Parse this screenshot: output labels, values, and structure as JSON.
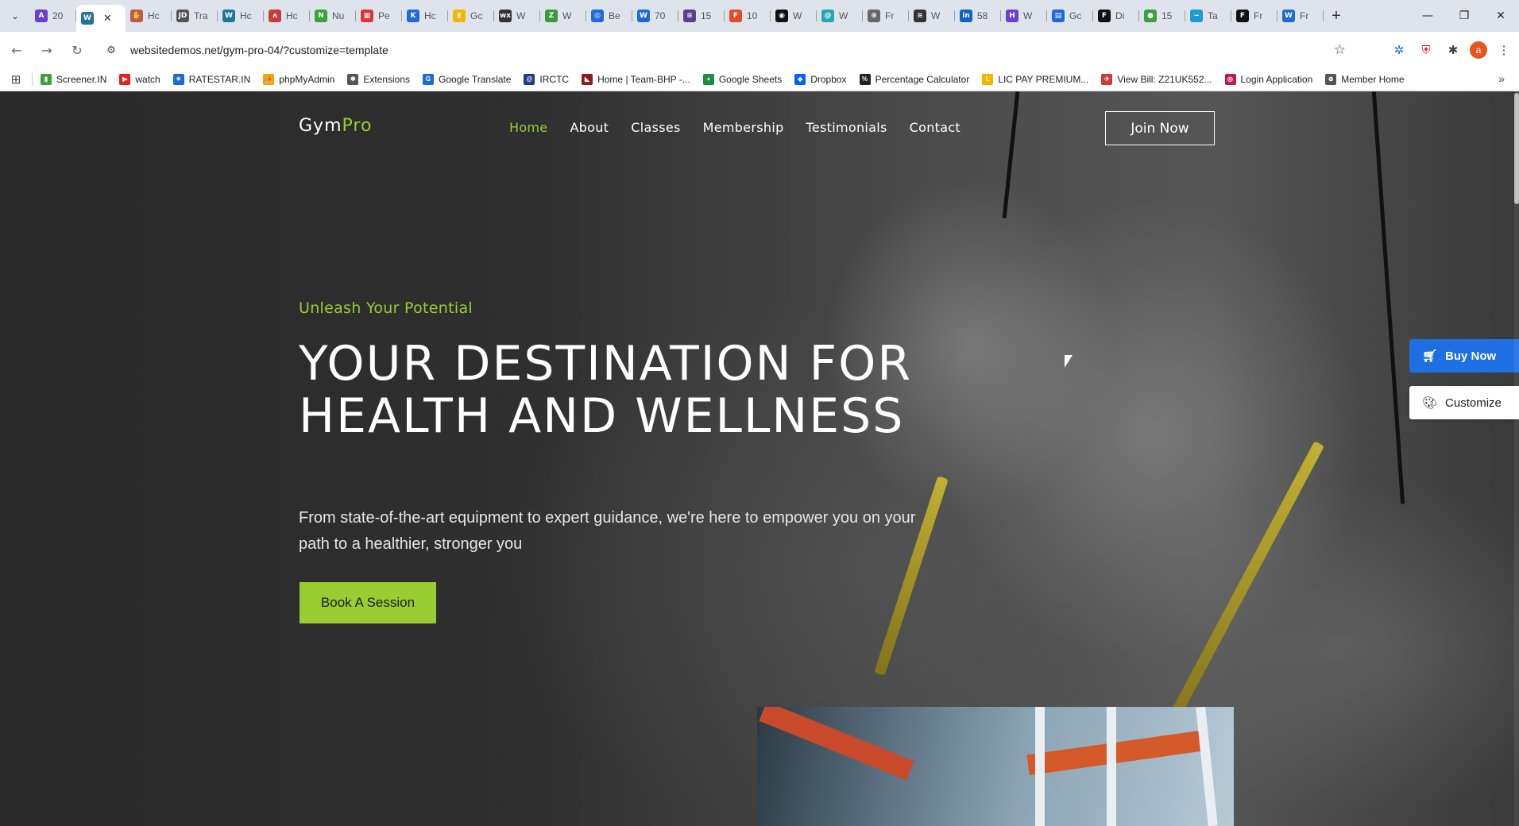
{
  "browser": {
    "tabs": [
      {
        "label": "20",
        "icon": "app-icon",
        "color": "#6b3fd6",
        "glyph": "A"
      },
      {
        "label": "",
        "icon": "wordpress-icon",
        "color": "#21759b",
        "glyph": "W",
        "active": true
      },
      {
        "label": "Hc",
        "icon": "hands-icon",
        "color": "#c0574a",
        "glyph": "✋"
      },
      {
        "label": "Tra",
        "icon": "jd-icon",
        "color": "#555555",
        "glyph": "JD"
      },
      {
        "label": "Hc",
        "icon": "wordpress-icon",
        "color": "#21759b",
        "glyph": "W"
      },
      {
        "label": "Hc",
        "icon": "wings-icon",
        "color": "#c83b3b",
        "glyph": "ʌ"
      },
      {
        "label": "Nu",
        "icon": "leaf-icon",
        "color": "#3aa13a",
        "glyph": "N"
      },
      {
        "label": "Pe",
        "icon": "calendar-icon",
        "color": "#d33",
        "glyph": "▦"
      },
      {
        "label": "Hc",
        "icon": "k-icon",
        "color": "#1e6bd6",
        "glyph": "K"
      },
      {
        "label": "Gc",
        "icon": "google-keep-icon",
        "color": "#f4b400",
        "glyph": "▮"
      },
      {
        "label": "W",
        "icon": "wix-icon",
        "color": "#333333",
        "glyph": "wx"
      },
      {
        "label": "W",
        "icon": "zoho-icon",
        "color": "#3a9a3a",
        "glyph": "Z"
      },
      {
        "label": "Be",
        "icon": "target-icon",
        "color": "#1e6bd6",
        "glyph": "◎"
      },
      {
        "label": "70",
        "icon": "word-icon",
        "color": "#1e6bd6",
        "glyph": "W"
      },
      {
        "label": "15",
        "icon": "stack-icon",
        "color": "#5b3f8a",
        "glyph": "≡"
      },
      {
        "label": "10",
        "icon": "figma-icon",
        "color": "#e24a2a",
        "glyph": "F"
      },
      {
        "label": "W",
        "icon": "gauge-icon",
        "color": "#111111",
        "glyph": "◉"
      },
      {
        "label": "W",
        "icon": "swirl-icon",
        "color": "#26a6b4",
        "glyph": "@"
      },
      {
        "label": "Fr",
        "icon": "globe-icon",
        "color": "#666666",
        "glyph": "⊕"
      },
      {
        "label": "W",
        "icon": "stripes-icon",
        "color": "#333333",
        "glyph": "≋"
      },
      {
        "label": "58",
        "icon": "linkedin-icon",
        "color": "#0a66c2",
        "glyph": "in"
      },
      {
        "label": "W",
        "icon": "h-icon",
        "color": "#6b3fd6",
        "glyph": "H"
      },
      {
        "label": "Gc",
        "icon": "table-icon",
        "color": "#1e6bd6",
        "glyph": "▤"
      },
      {
        "label": "Di",
        "icon": "f-circle-icon",
        "color": "#111111",
        "glyph": "F"
      },
      {
        "label": "15",
        "icon": "green-drop-icon",
        "color": "#3aa13a",
        "glyph": "●"
      },
      {
        "label": "Ta",
        "icon": "wave-icon",
        "color": "#1e9bd6",
        "glyph": "~"
      },
      {
        "label": "Fr",
        "icon": "fr-icon",
        "color": "#111111",
        "glyph": "F"
      },
      {
        "label": "Fr",
        "icon": "word-icon",
        "color": "#1e6bd6",
        "glyph": "W"
      }
    ],
    "url": "websitedemos.net/gym-pro-04/?customize=template",
    "profile_initial": "a",
    "bookmarks": [
      {
        "label": "Screener.IN",
        "icon": "bar-chart-icon",
        "color": "#3aa13a",
        "glyph": "▮"
      },
      {
        "label": "watch",
        "icon": "youtube-icon",
        "color": "#e62117",
        "glyph": "▶"
      },
      {
        "label": "RATESTAR.IN",
        "icon": "star-burst-icon",
        "color": "#1e6bd6",
        "glyph": "✶"
      },
      {
        "label": "phpMyAdmin",
        "icon": "sail-icon",
        "color": "#f4a300",
        "glyph": "⛵"
      },
      {
        "label": "Extensions",
        "icon": "puzzle-icon",
        "color": "#555555",
        "glyph": "✱"
      },
      {
        "label": "Google Translate",
        "icon": "translate-icon",
        "color": "#1e6bd6",
        "glyph": "G"
      },
      {
        "label": "IRCTC",
        "icon": "irctc-icon",
        "color": "#1e3a8a",
        "glyph": "@"
      },
      {
        "label": "Home | Team-BHP -...",
        "icon": "team-bhp-icon",
        "color": "#8a1c1c",
        "glyph": "◣"
      },
      {
        "label": "Google Sheets",
        "icon": "sheets-icon",
        "color": "#1e8e3e",
        "glyph": "+"
      },
      {
        "label": "Dropbox",
        "icon": "dropbox-icon",
        "color": "#0061fe",
        "glyph": "◆"
      },
      {
        "label": "Percentage Calculator",
        "icon": "percent-icon",
        "color": "#222222",
        "glyph": "%"
      },
      {
        "label": "LIC PAY PREMIUM...",
        "icon": "lic-icon",
        "color": "#f4b400",
        "glyph": "L"
      },
      {
        "label": "View Bill: Z21UK552...",
        "icon": "bill-icon",
        "color": "#c83b3b",
        "glyph": "✈"
      },
      {
        "label": "Login Application",
        "icon": "login-icon",
        "color": "#c2185b",
        "glyph": "◎"
      },
      {
        "label": "Member Home",
        "icon": "globe-icon",
        "color": "#555555",
        "glyph": "⊕"
      }
    ]
  },
  "site": {
    "logo_main": "Gym",
    "logo_accent": "Pro",
    "nav": [
      "Home",
      "About",
      "Classes",
      "Membership",
      "Testimonials",
      "Contact"
    ],
    "active_nav": "Home",
    "join_label": "Join Now",
    "hero": {
      "eyebrow": "Unleash Your Potential",
      "title": "YOUR DESTINATION FOR HEALTH AND WELLNESS",
      "subtitle": "From state-of-the-art equipment to expert guidance, we're here to empower you on your path to a healthier, stronger you",
      "cta": "Book A Session"
    },
    "side_buttons": {
      "buy_label": "Buy Now",
      "customize_label": "Customize"
    },
    "colors": {
      "accent": "#9acd32",
      "buy_button": "#1d6fe2"
    }
  }
}
